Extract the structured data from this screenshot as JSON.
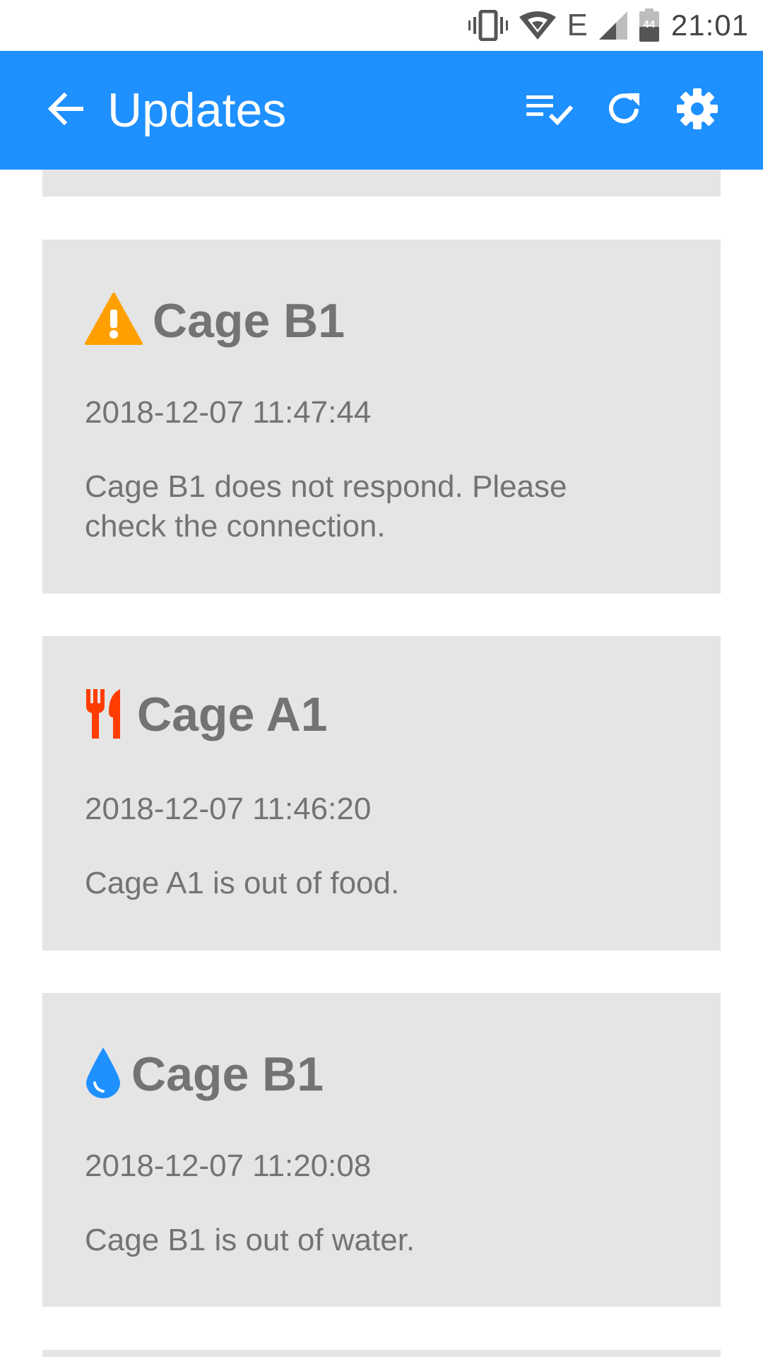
{
  "status_bar": {
    "time": "21:01",
    "network_type": "E",
    "battery_level": "44",
    "icons": [
      "vibrate-icon",
      "wifi-icon",
      "signal-icon",
      "battery-icon"
    ]
  },
  "app_bar": {
    "title": "Updates",
    "background_color": "#1e90ff",
    "icons": [
      "back-arrow-icon",
      "mark-all-read-icon",
      "refresh-icon",
      "settings-icon"
    ]
  },
  "updates": [
    {
      "icon": "warning-icon",
      "icon_color": "#ffa000",
      "title": "Cage B1",
      "timestamp": "2018-12-07 11:47:44",
      "message": "Cage B1 does not respond. Please check the connection."
    },
    {
      "icon": "food-icon",
      "icon_color": "#ff3d00",
      "title": "Cage A1",
      "timestamp": "2018-12-07 11:46:20",
      "message": "Cage A1 is out of food."
    },
    {
      "icon": "water-drop-icon",
      "icon_color": "#1e90ff",
      "title": "Cage B1",
      "timestamp": "2018-12-07 11:20:08",
      "message": "Cage B1 is out of water."
    }
  ],
  "colors": {
    "card_background": "#e5e5e5",
    "text": "#737373"
  }
}
